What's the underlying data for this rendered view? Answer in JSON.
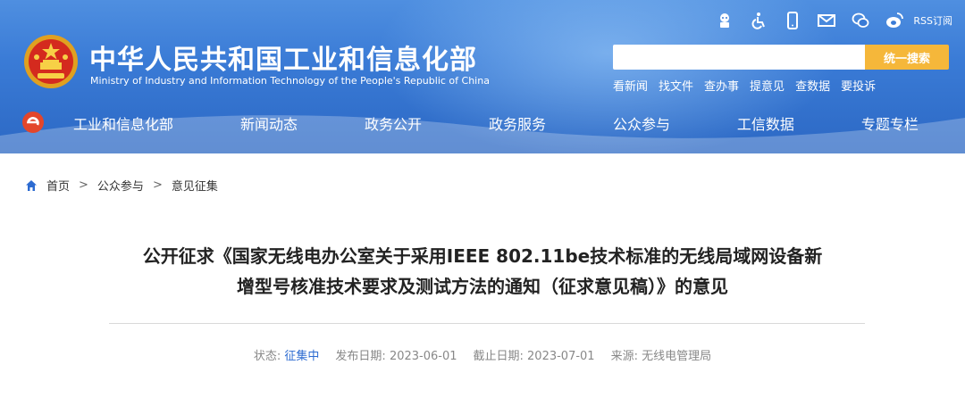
{
  "header": {
    "title_cn": "中华人民共和国工业和信息化部",
    "title_en": "Ministry of Industry and Information Technology of the People's Republic of China",
    "top_icons": [
      "robot-icon",
      "accessibility-icon",
      "mobile-icon",
      "mail-icon",
      "wechat-icon",
      "weibo-icon"
    ],
    "rss_label": "RSS订阅",
    "search": {
      "placeholder": "",
      "value": "",
      "button_label": "统一搜索"
    },
    "quick_links": [
      "看新闻",
      "找文件",
      "查办事",
      "提意见",
      "查数据",
      "要投诉"
    ]
  },
  "nav": {
    "items": [
      "工业和信息化部",
      "新闻动态",
      "政务公开",
      "政务服务",
      "公众参与",
      "工信数据",
      "专题专栏"
    ]
  },
  "breadcrumb": {
    "items": [
      "首页",
      "公众参与",
      "意见征集"
    ],
    "separator": ">"
  },
  "article": {
    "title_line1": "公开征求《国家无线电办公室关于采用IEEE 802.11be技术标准的无线局域网设备新",
    "title_line2": "增型号核准技术要求及测试方法的通知（征求意见稿）》的意见",
    "meta": {
      "status_label": "状态:",
      "status_value": "征集中",
      "publish_label": "发布日期:",
      "publish_date": "2023-06-01",
      "deadline_label": "截止日期:",
      "deadline_date": "2023-07-01",
      "source_label": "来源:",
      "source_value": "无线电管理局"
    }
  },
  "colors": {
    "header_blue": "#3a7bd6",
    "search_button": "#f5b73a",
    "status_blue": "#2c6bd1",
    "text_dark": "#222222",
    "meta_gray": "#888888"
  }
}
